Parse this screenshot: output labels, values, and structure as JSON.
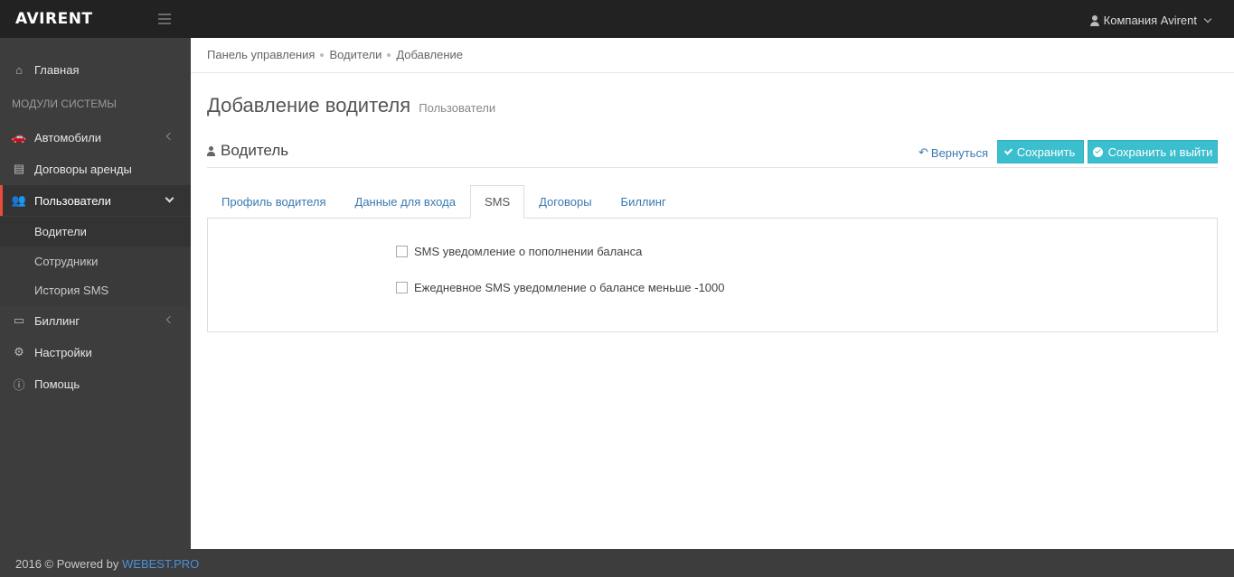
{
  "app": {
    "logo": "AVIRENT",
    "user_label": "Компания Avirent"
  },
  "sidebar": {
    "home": "Главная",
    "section_label": "Модули системы",
    "cars": "Автомобили",
    "contracts": "Договоры аренды",
    "users": "Пользователи",
    "users_sub": [
      "Водители",
      "Сотрудники",
      "История SMS"
    ],
    "billing": "Биллинг",
    "settings": "Настройки",
    "help": "Помощь"
  },
  "breadcrumb": [
    "Панель управления",
    "Водители",
    "Добавление"
  ],
  "page": {
    "title": "Добавление водителя",
    "subtitle": "Пользователи",
    "section_title": "Водитель",
    "back_label": "Вернуться",
    "save_label": "Сохранить",
    "save_exit_label": "Сохранить и выйти"
  },
  "tabs": [
    "Профиль водителя",
    "Данные для входа",
    "SMS",
    "Договоры",
    "Биллинг"
  ],
  "active_tab": "SMS",
  "sms_options": [
    {
      "label": "SMS уведомление о пополнении баланса",
      "checked": false
    },
    {
      "label": "Ежедневное SMS уведомление о балансе меньше -1000",
      "checked": false
    }
  ],
  "footer": {
    "text": "2016 © Powered by",
    "link": "WEBEST.PRO"
  },
  "colors": {
    "accent": "#3bbfce",
    "active_border": "#e74c3c",
    "link": "#3a7ab0"
  }
}
